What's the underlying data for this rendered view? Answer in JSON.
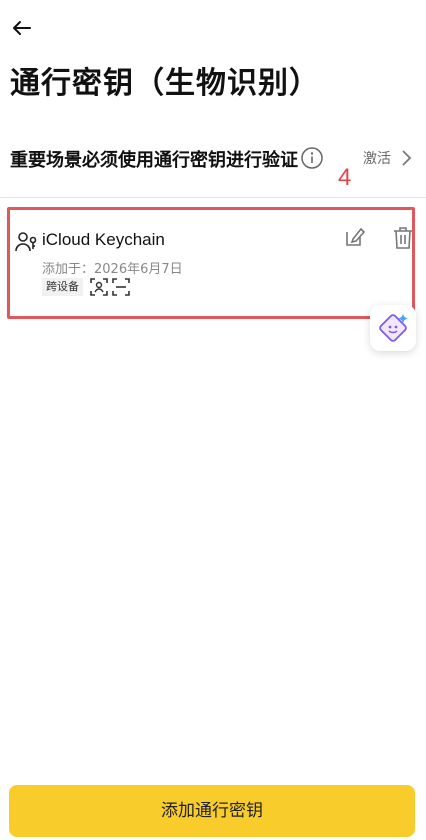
{
  "header": {
    "title": "通行密钥（生物识别）"
  },
  "setting": {
    "text": "重要场景必须使用通行密钥进行验证",
    "action": "激活"
  },
  "annotation": {
    "step": "4",
    "color": "#e0454a"
  },
  "passkey": {
    "name": "iCloud Keychain",
    "added": "添加于：2026年6月7日",
    "tag": "跨设备",
    "icons": [
      "face-id-icon",
      "scan-icon"
    ]
  },
  "footer": {
    "button_label": "添加通行密钥"
  },
  "colors": {
    "accent": "#f8cc2b",
    "highlight_border": "#e0575c"
  }
}
